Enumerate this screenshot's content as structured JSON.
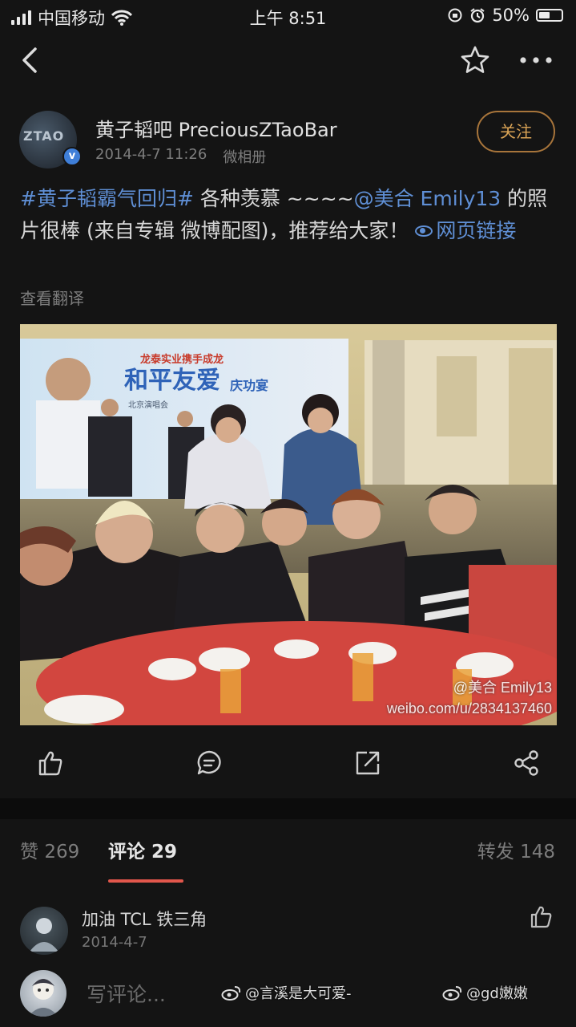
{
  "status_bar": {
    "carrier": "中国移动",
    "time": "上午 8:51",
    "battery": "50%",
    "battery_level": 0.5
  },
  "post": {
    "author": "黄子韬吧 PreciousZTaoBar",
    "avatar_text": "ZTAO",
    "date": "2014-4-7 11:26",
    "source": "微相册",
    "follow_label": "关注",
    "hashtag": "#黄子韬霸气回归#",
    "text_part1": " 各种羡慕 ~~~~",
    "mention": "@美合 Emily13",
    "text_part2": " 的照片很棒 (来自专辑 微博配图)，推荐给大家！ ",
    "web_link": "网页链接",
    "translate": "查看翻译"
  },
  "photo": {
    "banner_brand": "龙泰实业携手成龙",
    "banner_title": "和平友爱",
    "banner_suffix": "庆功宴",
    "banner_sub": "北京演唱会",
    "watermark_handle": "@美合 Emily13",
    "watermark_url": "weibo.com/u/2834137460"
  },
  "tabs": {
    "likes_label": "赞",
    "likes_count": "269",
    "comments_label": "评论",
    "comments_count": "29",
    "reposts_label": "转发",
    "reposts_count": "148"
  },
  "comment": {
    "name": "加油 TCL 铁三角",
    "date": "2014-4-7"
  },
  "compose": {
    "placeholder": "写评论...",
    "credit_1": "@言溪是大可爱-",
    "credit_2": "@gd嫩嫩"
  }
}
